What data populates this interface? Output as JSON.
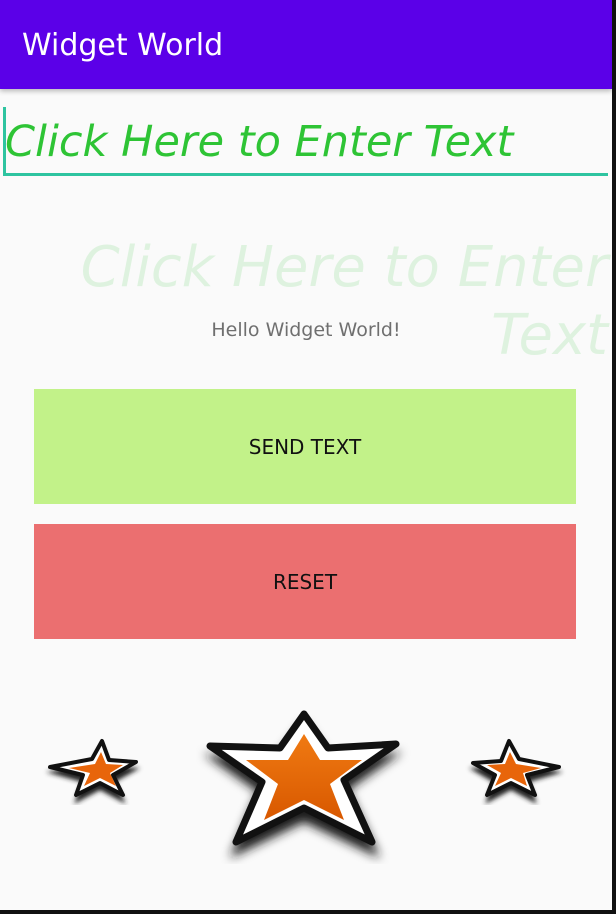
{
  "app": {
    "title": "Widget World"
  },
  "input": {
    "placeholder": "Click Here to Enter Text",
    "value": ""
  },
  "ghost_text": "Click Here to Enter Text",
  "message": "Hello Widget World!",
  "buttons": {
    "send_label": "SEND TEXT",
    "reset_label": "RESET"
  },
  "colors": {
    "appbar": "#5b00e8",
    "text_green": "#2ec435",
    "underline_teal": "#2ec4a0",
    "send_button": "#c2f289",
    "reset_button": "#eb6f70",
    "star_fill": "#e8650a"
  },
  "icons": [
    "star-icon",
    "star-icon",
    "star-icon"
  ]
}
